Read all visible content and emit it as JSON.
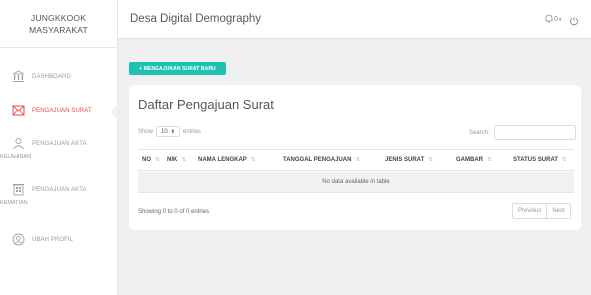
{
  "sidebar": {
    "brand_line1": "JUNGKKOOK",
    "brand_line2": "MASYARAKAT",
    "items": [
      {
        "label": "DASHBOARD"
      },
      {
        "label": "PENGAJUAN SURAT"
      },
      {
        "label": "PENGAJUAN AKTA",
        "label2": "KELAHIRAN"
      },
      {
        "label": "PENGAJUAN AKTA",
        "label2": "KEMATIAN"
      },
      {
        "label": "UBAH PROFIL"
      }
    ]
  },
  "header": {
    "title": "Desa Digital Demography",
    "notification_count": "0"
  },
  "main": {
    "new_button_label": "+ MENGAJUKAN SURAT BARU",
    "card_title": "Daftar Pengajuan Surat",
    "show_label": "Show",
    "page_length": "10",
    "entries_label": "entries",
    "search_label": "Search:",
    "search_value": "",
    "columns": [
      "NO",
      "NIK",
      "NAMA LENGKAP",
      "TANGGAL PENGAJUAN",
      "JENIS SURAT",
      "GAMBAR",
      "STATUS SURAT"
    ],
    "empty_message": "No data available in table",
    "info": "Showing 0 to 0 of 0 entries",
    "prev_label": "Previous",
    "next_label": "Next"
  },
  "colors": {
    "accent": "#1fc2b1",
    "active": "#e24c4b"
  }
}
